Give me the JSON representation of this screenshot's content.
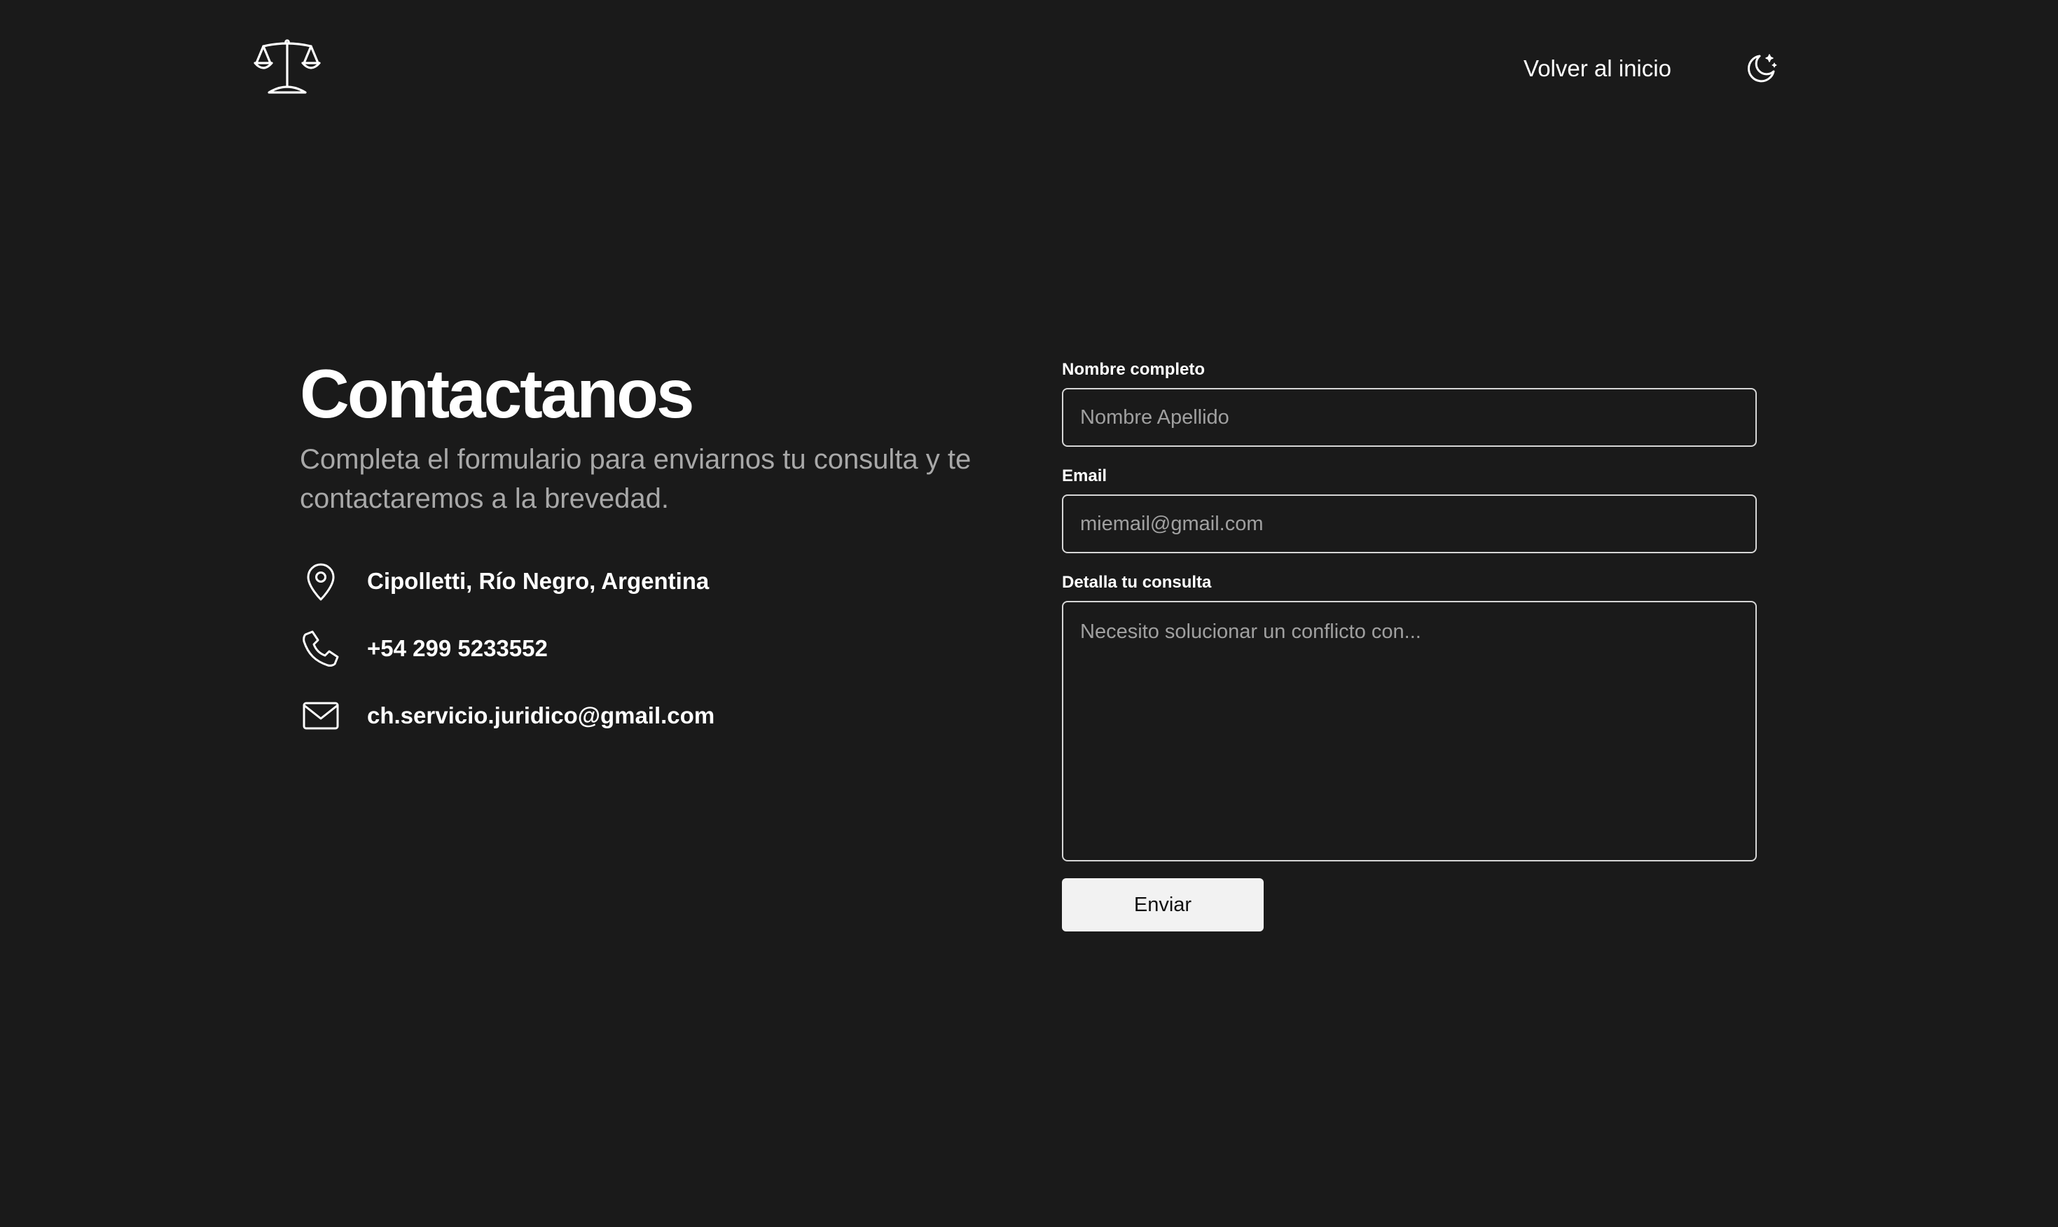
{
  "header": {
    "logo_icon": "scales-of-justice-icon",
    "home_link_label": "Volver al inicio",
    "theme_toggle_icon": "moon-star-icon"
  },
  "intro": {
    "title": "Contactanos",
    "subtitle": "Completa el formulario para enviarnos tu consulta y te contactaremos a la brevedad."
  },
  "contact": {
    "items": [
      {
        "icon": "map-pin-icon",
        "text": "Cipolletti, Río Negro, Argentina"
      },
      {
        "icon": "phone-icon",
        "text": "+54 299 5233552"
      },
      {
        "icon": "mail-icon",
        "text": "ch.servicio.juridico@gmail.com"
      }
    ]
  },
  "form": {
    "name": {
      "label": "Nombre completo",
      "placeholder": "Nombre Apellido",
      "value": ""
    },
    "email": {
      "label": "Email",
      "placeholder": "miemail@gmail.com",
      "value": ""
    },
    "message": {
      "label": "Detalla tu consulta",
      "placeholder": "Necesito solucionar un conflicto con...",
      "value": ""
    },
    "submit_label": "Enviar"
  },
  "colors": {
    "background": "#1a1a1a",
    "text": "#ffffff",
    "muted_text": "#a8a8a8",
    "button_bg": "#f2f2f2",
    "input_border": "#d6d6d6"
  }
}
